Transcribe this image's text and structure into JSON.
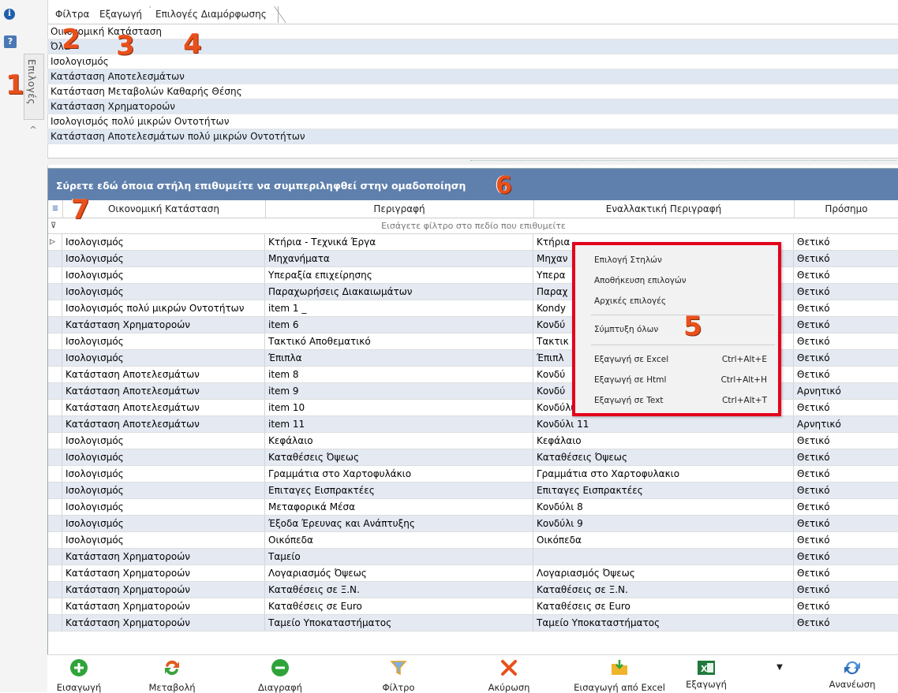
{
  "tabs": [
    "Φίλτρα",
    "Εξαγωγή",
    "Επιλογές Διαμόρφωσης"
  ],
  "side": {
    "options_tab": "Επιλογές",
    "collapse": "^"
  },
  "callouts": [
    "1",
    "2",
    "3",
    "4",
    "5",
    "6",
    "7"
  ],
  "statements": [
    "Οικονομική Κατάσταση",
    "Όλα",
    "Ισολογισμός",
    "Κατάσταση Αποτελεσμάτων",
    "Κατάσταση Μεταβολών Καθαρής Θέσης",
    "Κατάσταση Χρηματοροών",
    "Ισολογισμός πολύ μικρών Οντοτήτων",
    "Κατάσταση Αποτελεσμάτων πολύ μικρών Οντοτήτων"
  ],
  "grid": {
    "group_band": "Σύρετε εδώ όποια στήλη επιθυμείτε να συμπεριληφθεί στην ομαδοποίηση",
    "columns": [
      "Οικονομική Κατάσταση",
      "Περιγραφή",
      "Εναλλακτική Περιγραφή",
      "Πρόσημο"
    ],
    "filter_placeholder": "Εισάγετε φίλτρο στο πεδίο που επιθυμείτε",
    "rows": [
      [
        "Ισολογισμός",
        "Κτήρια - Τεχνικά Έργα",
        "Κτήρια",
        "Θετικό"
      ],
      [
        "Ισολογισμός",
        "Μηχανήματα",
        "Μηχαν",
        "Θετικό"
      ],
      [
        "Ισολογισμός",
        "Υπεραξία επιχείρησης",
        "Υπερα",
        "Θετικό"
      ],
      [
        "Ισολογισμός",
        "Παραχωρήσεις Διακαιωμάτων",
        "Παραχ",
        "Θετικό"
      ],
      [
        "Ισολογισμός πολύ μικρών Οντοτήτων",
        "item 1 _",
        "Kondy",
        "Θετικό"
      ],
      [
        "Κατάσταση Χρηματοροών",
        "item 6",
        "Κονδύ",
        "Θετικό"
      ],
      [
        "Ισολογισμός",
        "Τακτικό Αποθεματικό",
        "Τακτικ",
        "Θετικό"
      ],
      [
        "Ισολογισμός",
        "Έπιπλα",
        "Έπιπλ",
        "Θετικό"
      ],
      [
        "Κατάσταση Αποτελεσμάτων",
        "item 8",
        "Κονδύ",
        "Θετικό"
      ],
      [
        "Κατάσταση Αποτελεσμάτων",
        "item 9",
        "Κονδύ",
        "Αρνητικό"
      ],
      [
        "Κατάσταση Αποτελεσμάτων",
        "item 10",
        "Κονδύλι 10",
        "Θετικό"
      ],
      [
        "Κατάσταση Αποτελεσμάτων",
        "item 11",
        "Κονδύλι 11",
        "Αρνητικό"
      ],
      [
        "Ισολογισμός",
        "Κεφάλαιο",
        "Κεφάλαιο",
        "Θετικό"
      ],
      [
        "Ισολογισμός",
        "Καταθέσεις Όψεως",
        "Καταθέσεις Όψεως",
        "Θετικό"
      ],
      [
        "Ισολογισμός",
        "Γραμμάτια στο Χαρτοφυλάκιο",
        "Γραμμάτια στο Χαρτοφυλακιο",
        "Θετικό"
      ],
      [
        "Ισολογισμός",
        "Επιταγες Εισπρακτέες",
        "Επιταγες Εισπρακτέες",
        "Θετικό"
      ],
      [
        "Ισολογισμός",
        "Μεταφορικά Μέσα",
        "Κονδύλι 8",
        "Θετικό"
      ],
      [
        "Ισολογισμός",
        "Έξοδα Έρευνας και Ανάπτυξης",
        "Κονδύλι 9",
        "Θετικό"
      ],
      [
        "Ισολογισμός",
        "Οικόπεδα",
        "Οικόπεδα",
        "Θετικό"
      ],
      [
        "Κατάσταση Χρηματοροών",
        "Ταμείο",
        "",
        "Θετικό"
      ],
      [
        "Κατάσταση Χρηματοροών",
        "Λογαριασμός Όψεως",
        "Λογαριασμός Όψεως",
        "Θετικό"
      ],
      [
        "Κατάσταση Χρηματοροών",
        "Καταθέσεις σε Ξ.Ν.",
        "Καταθέσεις σε Ξ.Ν.",
        "Θετικό"
      ],
      [
        "Κατάσταση Χρηματοροών",
        "Καταθέσεις σε Euro",
        "Καταθέσεις σε Euro",
        "Θετικό"
      ],
      [
        "Κατάσταση Χρηματοροών",
        "Ταμείο Υποκαταστήματος",
        "Ταμείο Υποκαταστήματος",
        "Θετικό"
      ]
    ]
  },
  "context_menu": {
    "choose_columns": "Επιλογή Στηλών",
    "save_options": "Αποθήκευση επιλογών",
    "default_options": "Αρχικές επιλογές",
    "collapse_all": "Σύμπτυξη όλων",
    "export_excel": "Εξαγωγή σε Excel",
    "export_excel_sc": "Ctrl+Alt+E",
    "export_html": "Εξαγωγή σε Html",
    "export_html_sc": "Ctrl+Alt+H",
    "export_text": "Εξαγωγή σε Text",
    "export_text_sc": "Ctrl+Alt+T"
  },
  "toolbar": {
    "insert": "Εισαγωγή",
    "modify": "Μεταβολή",
    "delete": "Διαγραφή",
    "filter": "Φίλτρο",
    "cancel": "Ακύρωση",
    "import_excel": "Εισαγωγή από Excel",
    "export": "Εξαγωγή",
    "refresh": "Ανανέωση"
  },
  "colors": {
    "accent": "#5f80ad",
    "row_alt": "#e4e9f2",
    "callout": "#e8501c",
    "menu_border": "#e4001b"
  }
}
